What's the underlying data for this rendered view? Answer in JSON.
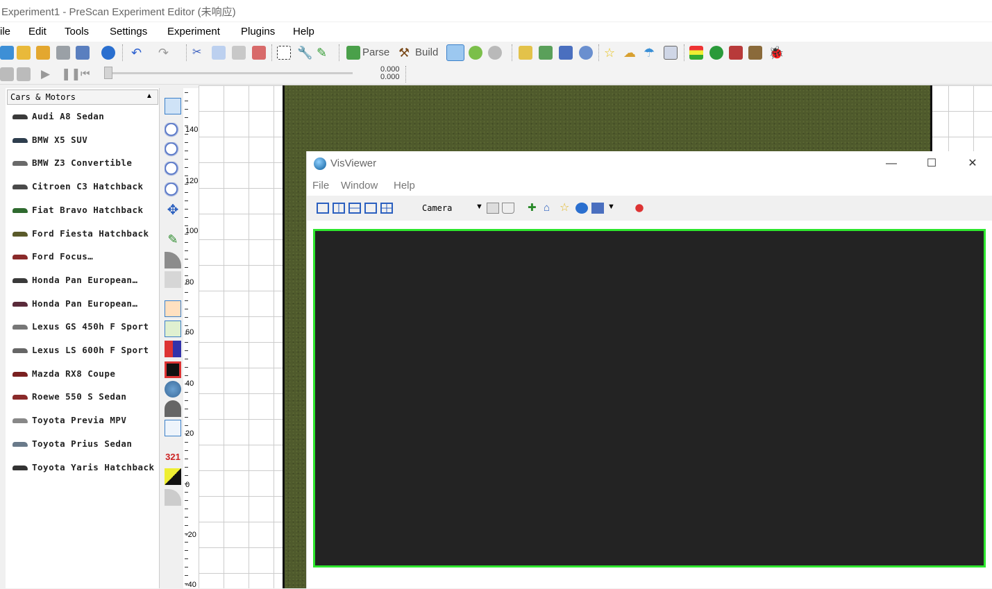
{
  "window": {
    "title": "Experiment1 - PreScan Experiment Editor (未响应)"
  },
  "menu": [
    "ile",
    "Edit",
    "Tools",
    "Settings",
    "Experiment",
    "Plugins",
    "Help"
  ],
  "toolbar": {
    "parse": "Parse",
    "build": "Build",
    "time_top": "0.000",
    "time_bottom": "0.000"
  },
  "library": {
    "header": "Cars & Motors",
    "items": [
      {
        "label": "Audi A8 Sedan",
        "color": "#3a3a3a"
      },
      {
        "label": "BMW X5 SUV",
        "color": "#2e3e4e"
      },
      {
        "label": "BMW Z3 Convertible",
        "color": "#6a6a6a"
      },
      {
        "label": "Citroen C3 Hatchback",
        "color": "#4a4a4a"
      },
      {
        "label": "Fiat Bravo Hatchback",
        "color": "#2f6a2f"
      },
      {
        "label": "Ford Fiesta Hatchback",
        "color": "#5a5a2a"
      },
      {
        "label": "Ford Focus…",
        "color": "#8a2a2a"
      },
      {
        "label": "Honda Pan European…",
        "color": "#3a3a3a"
      },
      {
        "label": "Honda Pan European…",
        "color": "#5a2a3a"
      },
      {
        "label": "Lexus GS 450h F Sport",
        "color": "#777777"
      },
      {
        "label": "Lexus LS 600h F Sport",
        "color": "#666666"
      },
      {
        "label": "Mazda RX8 Coupe",
        "color": "#7a2020"
      },
      {
        "label": "Roewe 550 S Sedan",
        "color": "#8a2a2a"
      },
      {
        "label": "Toyota Previa MPV",
        "color": "#888888"
      },
      {
        "label": "Toyota Prius Sedan",
        "color": "#6a7a8a"
      },
      {
        "label": "Toyota Yaris Hatchback",
        "color": "#333333"
      }
    ]
  },
  "ruler": [
    "140",
    "120",
    "100",
    "80",
    "60",
    "40",
    "20",
    "0",
    "-20",
    "-40"
  ],
  "visviewer": {
    "title": "VisViewer",
    "menu": [
      "File",
      "Window",
      "Help"
    ],
    "camera": "Camera",
    "border_color": "#2ee62e"
  }
}
